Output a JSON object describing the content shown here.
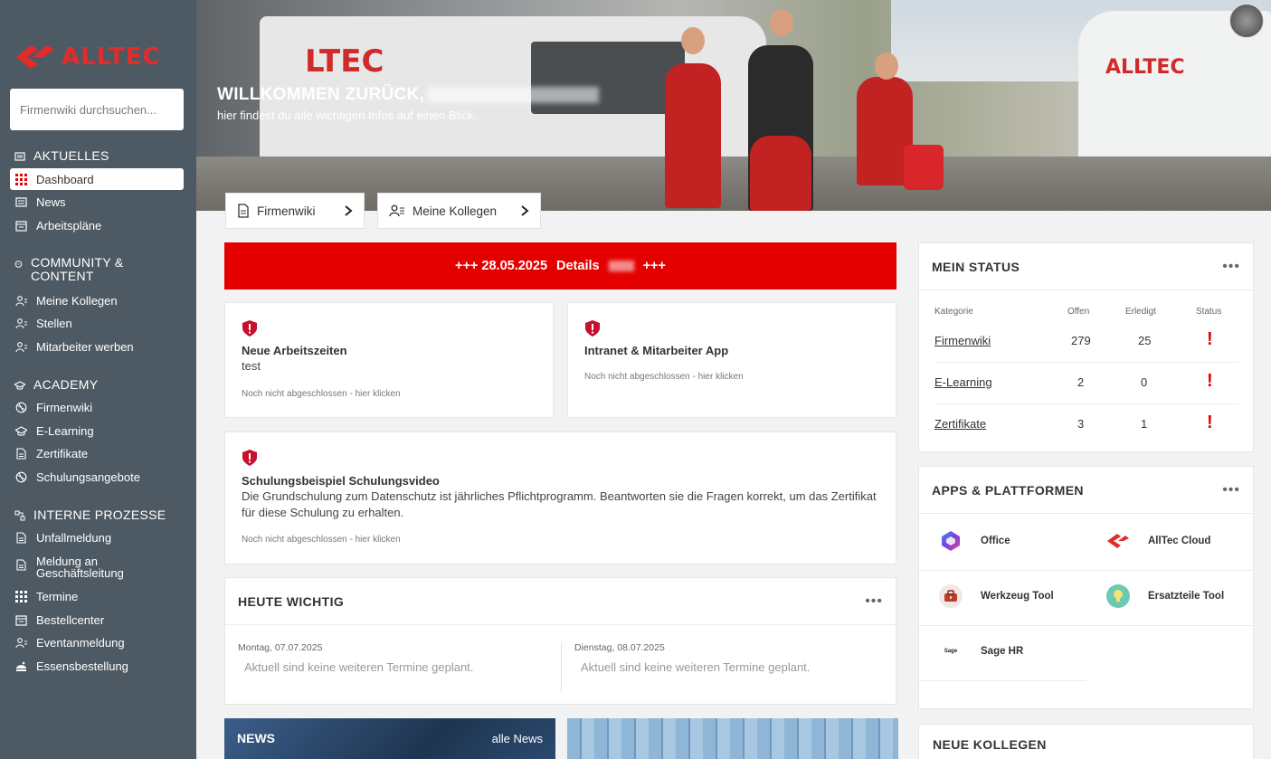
{
  "brand": {
    "name": "ALLTEC",
    "accent": "#e50000"
  },
  "search": {
    "placeholder": "Firmenwiki durchsuchen..."
  },
  "sidebar": {
    "sections": [
      {
        "title": "AKTUELLES",
        "icon": "newspaper-icon",
        "items": [
          {
            "label": "Dashboard",
            "icon": "grid-icon",
            "active": true
          },
          {
            "label": "News",
            "icon": "newspaper-icon"
          },
          {
            "label": "Arbeitspläne",
            "icon": "calendar-icon"
          }
        ]
      },
      {
        "title": "COMMUNITY & CONTENT",
        "icon": "chat-icon",
        "items": [
          {
            "label": "Meine Kollegen",
            "icon": "users-icon"
          },
          {
            "label": "Stellen",
            "icon": "users-icon"
          },
          {
            "label": "Mitarbeiter werben",
            "icon": "users-icon"
          }
        ]
      },
      {
        "title": "ACADEMY",
        "icon": "graduation-icon",
        "items": [
          {
            "label": "Firmenwiki",
            "icon": "globe-icon"
          },
          {
            "label": "E-Learning",
            "icon": "graduation-icon"
          },
          {
            "label": "Zertifikate",
            "icon": "document-icon"
          },
          {
            "label": "Schulungsangebote",
            "icon": "globe-icon"
          }
        ]
      },
      {
        "title": "INTERNE PROZESSE",
        "icon": "process-icon",
        "items": [
          {
            "label": "Unfallmeldung",
            "icon": "document-icon"
          },
          {
            "label": "Meldung an Geschäftsleitung",
            "icon": "document-icon"
          },
          {
            "label": "Termine",
            "icon": "grid-icon"
          },
          {
            "label": "Bestellcenter",
            "icon": "calendar-icon"
          },
          {
            "label": "Eventanmeldung",
            "icon": "users-icon"
          },
          {
            "label": "Essensbestellung",
            "icon": "food-icon"
          }
        ]
      }
    ]
  },
  "hero": {
    "title": "WILLKOMMEN ZURÜCK,",
    "subtitle": "hier findest du alle wichtigen Infos auf einen Blick.",
    "buttons": [
      {
        "label": "Firmenwiki",
        "icon": "document-icon"
      },
      {
        "label": "Meine Kollegen",
        "icon": "users-icon"
      }
    ],
    "van_logo": "LTEC",
    "van_logo2": "ALLTEC"
  },
  "alert": {
    "text": "+++ 28.05.2025",
    "details": "Details",
    "end": "+++"
  },
  "tasks": [
    {
      "title": "Neue Arbeitszeiten",
      "desc": "test",
      "status": "Noch nicht abgeschlossen - hier klicken"
    },
    {
      "title": "Intranet & Mitarbeiter App",
      "desc": "",
      "status": "Noch nicht abgeschlossen - hier klicken"
    },
    {
      "title": "Schulungsbeispiel Schulungsvideo",
      "desc": "Die Grundschulung zum Datenschutz ist jährliches Pflichtprogramm. Beantworten sie die Fragen korrekt, um das Zertifikat für diese Schulung zu erhalten.",
      "status": "Noch nicht abgeschlossen - hier klicken"
    }
  ],
  "heute": {
    "title": "HEUTE WICHTIG",
    "menu": "•••",
    "days": [
      {
        "date": "Montag, 07.07.2025",
        "message": "Aktuell sind keine weiteren Termine geplant."
      },
      {
        "date": "Dienstag, 08.07.2025",
        "message": "Aktuell sind keine weiteren Termine geplant."
      }
    ]
  },
  "news": {
    "title": "NEWS",
    "link": "alle News"
  },
  "status": {
    "title": "MEIN STATUS",
    "menu": "•••",
    "headers": {
      "kategorie": "Kategorie",
      "offen": "Offen",
      "erledigt": "Erledigt",
      "status": "Status"
    },
    "rows": [
      {
        "kategorie": "Firmenwiki",
        "offen": "279",
        "erledigt": "25",
        "status": "!"
      },
      {
        "kategorie": "E-Learning",
        "offen": "2",
        "erledigt": "0",
        "status": "!"
      },
      {
        "kategorie": "Zertifikate",
        "offen": "3",
        "erledigt": "1",
        "status": "!"
      }
    ]
  },
  "apps": {
    "title": "APPS & PLATTFORMEN",
    "menu": "•••",
    "items": [
      {
        "label": "Office",
        "icon": "office-icon"
      },
      {
        "label": "AllTec Cloud",
        "icon": "alltec-cloud-icon"
      },
      {
        "label": "Werkzeug Tool",
        "icon": "toolbox-icon"
      },
      {
        "label": "Ersatzteile Tool",
        "icon": "lightbulb-icon"
      },
      {
        "label": "Sage HR",
        "icon": "sage-icon"
      }
    ],
    "sage_mark": "Sage"
  },
  "neue_kollegen": {
    "title": "NEUE KOLLEGEN"
  }
}
